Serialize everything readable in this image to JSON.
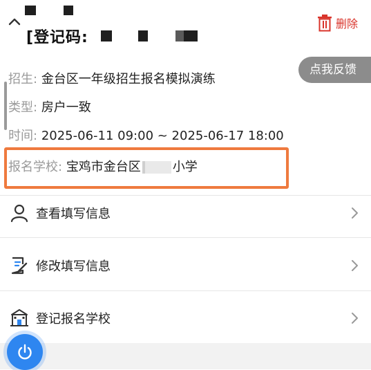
{
  "header": {
    "reg_code_label": "[登记码:",
    "delete_label": "删除"
  },
  "feedback": {
    "label": "点我反馈"
  },
  "info": {
    "enroll_label": "招生:",
    "enroll_value": "金台区一年级招生报名模拟演练",
    "type_label": "类型:",
    "type_value": "房户一致",
    "time_label": "时间:",
    "time_value": "2025-06-11 09:00 ~ 2025-06-17 18:00",
    "school_label": "报名学校:",
    "school_value_prefix": "宝鸡市金台区",
    "school_value_suffix": "小学"
  },
  "menu": {
    "items": [
      {
        "label": "查看填写信息",
        "icon": "user-icon"
      },
      {
        "label": "修改填写信息",
        "icon": "edit-document-icon"
      },
      {
        "label": "登记报名学校",
        "icon": "school-building-icon"
      }
    ]
  },
  "colors": {
    "accent_red": "#d9342b",
    "highlight_orange": "#ef7a3e",
    "power_blue": "#2e86f0",
    "feedback_gray": "#8c8c8c"
  }
}
